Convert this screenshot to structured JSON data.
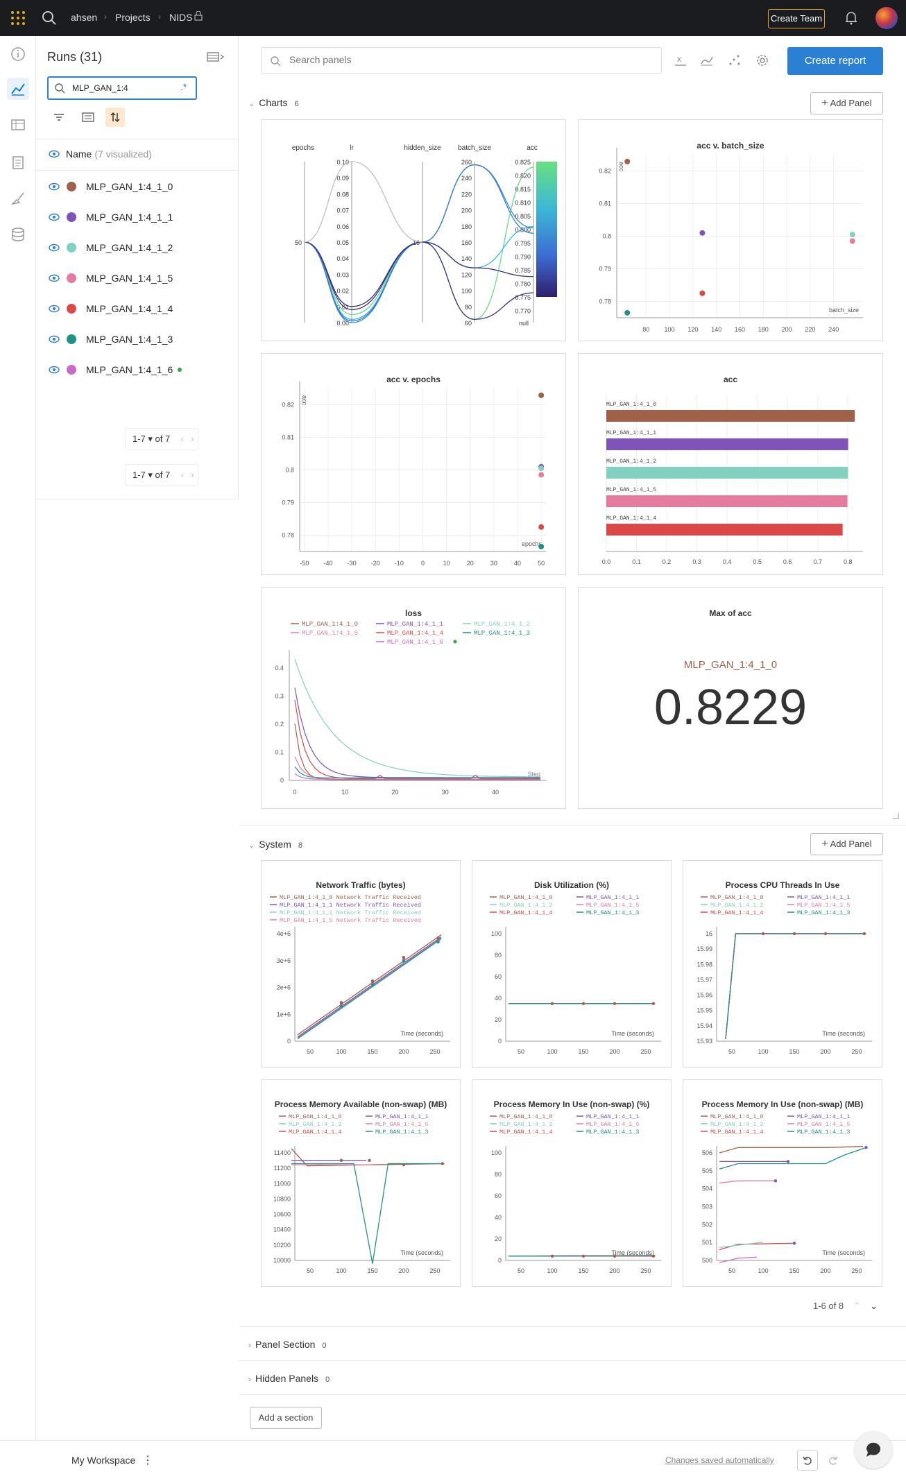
{
  "topbar": {
    "user": "ahsen",
    "projects": "Projects",
    "project": "NIDS",
    "create_team": "Create Team"
  },
  "runs_panel": {
    "title": "Runs (31)",
    "search_value": "MLP_GAN_1:4",
    "regex": ".*",
    "name_header": "Name",
    "visualized": "(7 visualized)",
    "runs": [
      {
        "name": "MLP_GAN_1:4_1_0",
        "color": "#a0614b"
      },
      {
        "name": "MLP_GAN_1:4_1_1",
        "color": "#7e54b9"
      },
      {
        "name": "MLP_GAN_1:4_1_2",
        "color": "#82d0c0"
      },
      {
        "name": "MLP_GAN_1:4_1_5",
        "color": "#e57ca0"
      },
      {
        "name": "MLP_GAN_1:4_1_4",
        "color": "#dc4848"
      },
      {
        "name": "MLP_GAN_1:4_1_3",
        "color": "#229082"
      },
      {
        "name": "MLP_GAN_1:4_1_6",
        "color": "#c86bc8"
      }
    ],
    "pager1": "1-7 ▾  of 7",
    "pager2": "1-7 ▾  of 7"
  },
  "main": {
    "search_placeholder": "Search panels",
    "create_report": "Create report",
    "charts_label": "Charts",
    "charts_count": "6",
    "add_panel": "Add Panel",
    "system_label": "System",
    "system_count": "8",
    "pager": "1-6 of 8",
    "panel_section": "Panel Section",
    "panel_section_count": "0",
    "hidden_panels": "Hidden Panels",
    "hidden_panels_count": "0",
    "add_section": "Add a section"
  },
  "footer": {
    "workspace": "My Workspace",
    "saved": "Changes saved automatically"
  },
  "chart_data": [
    {
      "type": "parallel",
      "columns": [
        "epochs",
        "lr",
        "hidden_size",
        "batch_size",
        "acc"
      ],
      "lr_ticks": [
        "0.10",
        "0.09",
        "0.08",
        "0.07",
        "0.06",
        "0.05",
        "0.04",
        "0.03",
        "0.02",
        "0.01",
        "0.00"
      ],
      "batch_ticks": [
        "260",
        "240",
        "220",
        "200",
        "180",
        "160",
        "140",
        "120",
        "100",
        "80",
        "60"
      ],
      "acc_ticks": [
        "0.825",
        "0.820",
        "0.815",
        "0.810",
        "0.805",
        "0.800",
        "0.795",
        "0.790",
        "0.785",
        "0.780",
        "0.775",
        "0.770"
      ],
      "epochs_val": "50",
      "hidden_val": "16",
      "null_label": "null"
    },
    {
      "type": "scatter",
      "title": "acc v. batch_size",
      "xlabel": "batch_size",
      "ylabel": "acc",
      "xticks": [
        "80",
        "100",
        "120",
        "140",
        "160",
        "180",
        "200",
        "220",
        "240"
      ],
      "yticks": [
        "0.82",
        "0.81",
        "0.8",
        "0.79",
        "0.78"
      ],
      "points": [
        {
          "x": 64,
          "y": 0.8229,
          "run": "MLP_GAN_1:4_1_0"
        },
        {
          "x": 128,
          "y": 0.801,
          "run": "MLP_GAN_1:4_1_1"
        },
        {
          "x": 256,
          "y": 0.8005,
          "run": "MLP_GAN_1:4_1_2"
        },
        {
          "x": 256,
          "y": 0.7985,
          "run": "MLP_GAN_1:4_1_5"
        },
        {
          "x": 128,
          "y": 0.7825,
          "run": "MLP_GAN_1:4_1_4"
        },
        {
          "x": 64,
          "y": 0.7765,
          "run": "MLP_GAN_1:4_1_3"
        }
      ]
    },
    {
      "type": "scatter",
      "title": "acc v. epochs",
      "xlabel": "epochs",
      "ylabel": "acc",
      "xticks": [
        "-50",
        "-40",
        "-30",
        "-20",
        "-10",
        "0",
        "10",
        "20",
        "30",
        "40",
        "50"
      ],
      "yticks": [
        "0.82",
        "0.81",
        "0.8",
        "0.79",
        "0.78"
      ],
      "points": [
        {
          "x": 50,
          "y": 0.8229
        },
        {
          "x": 50,
          "y": 0.801
        },
        {
          "x": 50,
          "y": 0.8005
        },
        {
          "x": 50,
          "y": 0.7985
        },
        {
          "x": 50,
          "y": 0.7825
        },
        {
          "x": 50,
          "y": 0.7765
        }
      ]
    },
    {
      "type": "bar",
      "title": "acc",
      "categories": [
        "MLP_GAN_1:4_1_0",
        "MLP_GAN_1:4_1_1",
        "MLP_GAN_1:4_1_2",
        "MLP_GAN_1:4_1_5",
        "MLP_GAN_1:4_1_4"
      ],
      "values": [
        0.8229,
        0.801,
        0.8005,
        0.7985,
        0.7825
      ],
      "xticks": [
        "0.0",
        "0.1",
        "0.2",
        "0.3",
        "0.4",
        "0.5",
        "0.6",
        "0.7",
        "0.8"
      ],
      "xlim": [
        0,
        0.85
      ]
    },
    {
      "type": "line",
      "title": "loss",
      "xlabel": "Step",
      "legend": [
        "MLP_GAN_1:4_1_0",
        "MLP_GAN_1:4_1_1",
        "MLP_GAN_1:4_1_2",
        "MLP_GAN_1:4_1_5",
        "MLP_GAN_1:4_1_4",
        "MLP_GAN_1:4_1_3",
        "MLP_GAN_1:4_1_6"
      ],
      "xticks": [
        "0",
        "10",
        "20",
        "30",
        "40"
      ],
      "yticks": [
        "0.4",
        "0.3",
        "0.2",
        "0.1",
        "0"
      ]
    },
    {
      "type": "value",
      "title": "Max of acc",
      "run": "MLP_GAN_1:4_1_0",
      "value": "0.8229"
    }
  ],
  "system_charts": [
    {
      "title": "Network Traffic (bytes)",
      "legend": [
        "MLP_GAN_1:4_1_0 Network Traffic Received",
        "MLP_GAN_1:4_1_1 Network Traffic Received",
        "MLP_GAN_1:4_1_2 Network Traffic Received",
        "MLP_GAN_1:4_1_5 Network Traffic Received"
      ],
      "yticks": [
        "4e+6",
        "3e+6",
        "2e+6",
        "1e+6",
        "0"
      ],
      "xticks": [
        "50",
        "100",
        "150",
        "200",
        "250"
      ],
      "xlabel": "Time (seconds)"
    },
    {
      "title": "Disk Utilization (%)",
      "yticks": [
        "100",
        "80",
        "60",
        "40",
        "20",
        "0"
      ],
      "xticks": [
        "50",
        "100",
        "150",
        "200",
        "250"
      ],
      "xlabel": "Time (seconds)"
    },
    {
      "title": "Process CPU Threads In Use",
      "yticks": [
        "16",
        "15.99",
        "15.98",
        "15.97",
        "15.96",
        "15.95",
        "15.94",
        "15.93"
      ],
      "xticks": [
        "50",
        "100",
        "150",
        "200",
        "250"
      ],
      "xlabel": "Time (seconds)"
    },
    {
      "title": "Process Memory Available (non-swap) (MB)",
      "yticks": [
        "11400",
        "11200",
        "11000",
        "10800",
        "10600",
        "10400",
        "10200",
        "10000"
      ],
      "xticks": [
        "50",
        "100",
        "150",
        "200",
        "250"
      ],
      "xlabel": "Time (seconds)"
    },
    {
      "title": "Process Memory In Use (non-swap) (%)",
      "yticks": [
        "100",
        "80",
        "60",
        "40",
        "20",
        "0"
      ],
      "xticks": [
        "50",
        "100",
        "150",
        "200",
        "250"
      ],
      "xlabel": "Time (seconds)"
    },
    {
      "title": "Process Memory In Use (non-swap) (MB)",
      "yticks": [
        "506",
        "505",
        "504",
        "503",
        "502",
        "501",
        "500"
      ],
      "xticks": [
        "50",
        "100",
        "150",
        "200",
        "250"
      ],
      "xlabel": "Time (seconds)"
    }
  ],
  "legend_runs": [
    "MLP_GAN_1:4_1_0",
    "MLP_GAN_1:4_1_1",
    "MLP_GAN_1:4_1_2",
    "MLP_GAN_1:4_1_5",
    "MLP_GAN_1:4_1_4",
    "MLP_GAN_1:4_1_3",
    "MLP_GAN_1:4_1_6"
  ]
}
